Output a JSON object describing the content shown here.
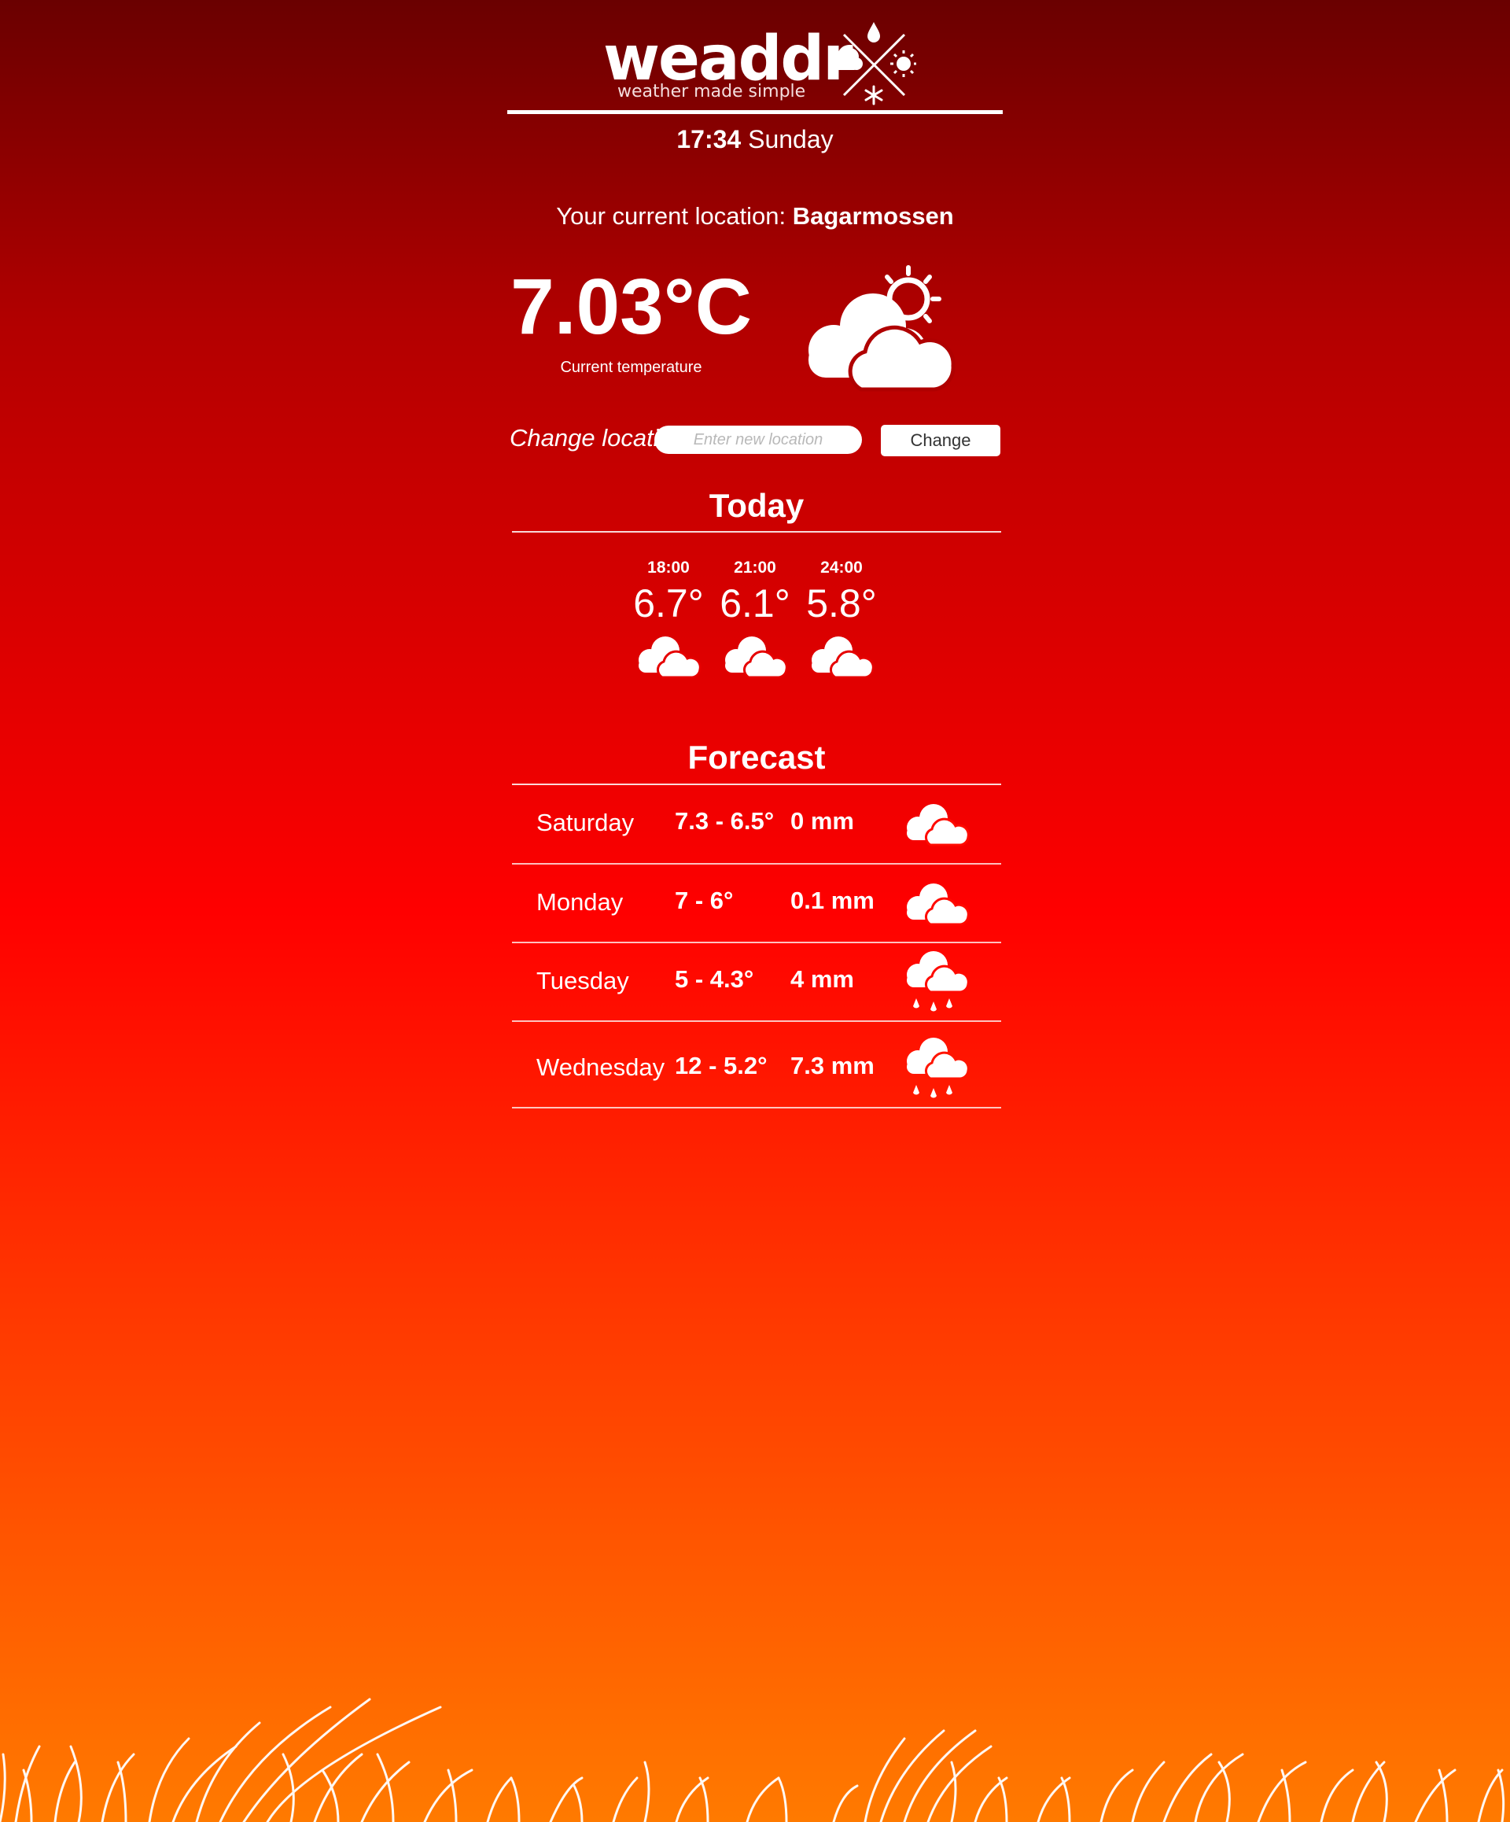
{
  "header": {
    "logo_text": "weaddr",
    "tagline": "weather made simple",
    "time": "17:34",
    "day": "Sunday"
  },
  "location": {
    "label": "Your current location:",
    "name": "Bagarmossen"
  },
  "current": {
    "temperature": "7.03°C",
    "label": "Current temperature",
    "icon": "partly-cloudy-sun-icon"
  },
  "change_location": {
    "label": "Change location:",
    "placeholder": "Enter new location",
    "value": "",
    "button_label": "Change"
  },
  "today": {
    "title": "Today",
    "hours": [
      {
        "time": "18:00",
        "temp": "6.7°",
        "icon": "cloudy-icon"
      },
      {
        "time": "21:00",
        "temp": "6.1°",
        "icon": "cloudy-icon"
      },
      {
        "time": "24:00",
        "temp": "5.8°",
        "icon": "cloudy-icon"
      }
    ]
  },
  "forecast": {
    "title": "Forecast",
    "days": [
      {
        "day": "Saturday",
        "range": "7.3 - 6.5°",
        "rain": "0 mm",
        "icon": "cloudy-icon"
      },
      {
        "day": "Monday",
        "range": "7 - 6°",
        "rain": "0.1 mm",
        "icon": "cloudy-icon"
      },
      {
        "day": "Tuesday",
        "range": "5 - 4.3°",
        "rain": "4 mm",
        "icon": "rain-cloud-icon"
      },
      {
        "day": "Wednesday",
        "range": "12 - 5.2°",
        "rain": "7.3 mm",
        "icon": "rain-cloud-icon"
      }
    ]
  },
  "colors": {
    "background_top": "#6a0000",
    "background_middle": "#ff0000",
    "background_bottom": "#ff7a00",
    "text": "#ffffff"
  }
}
